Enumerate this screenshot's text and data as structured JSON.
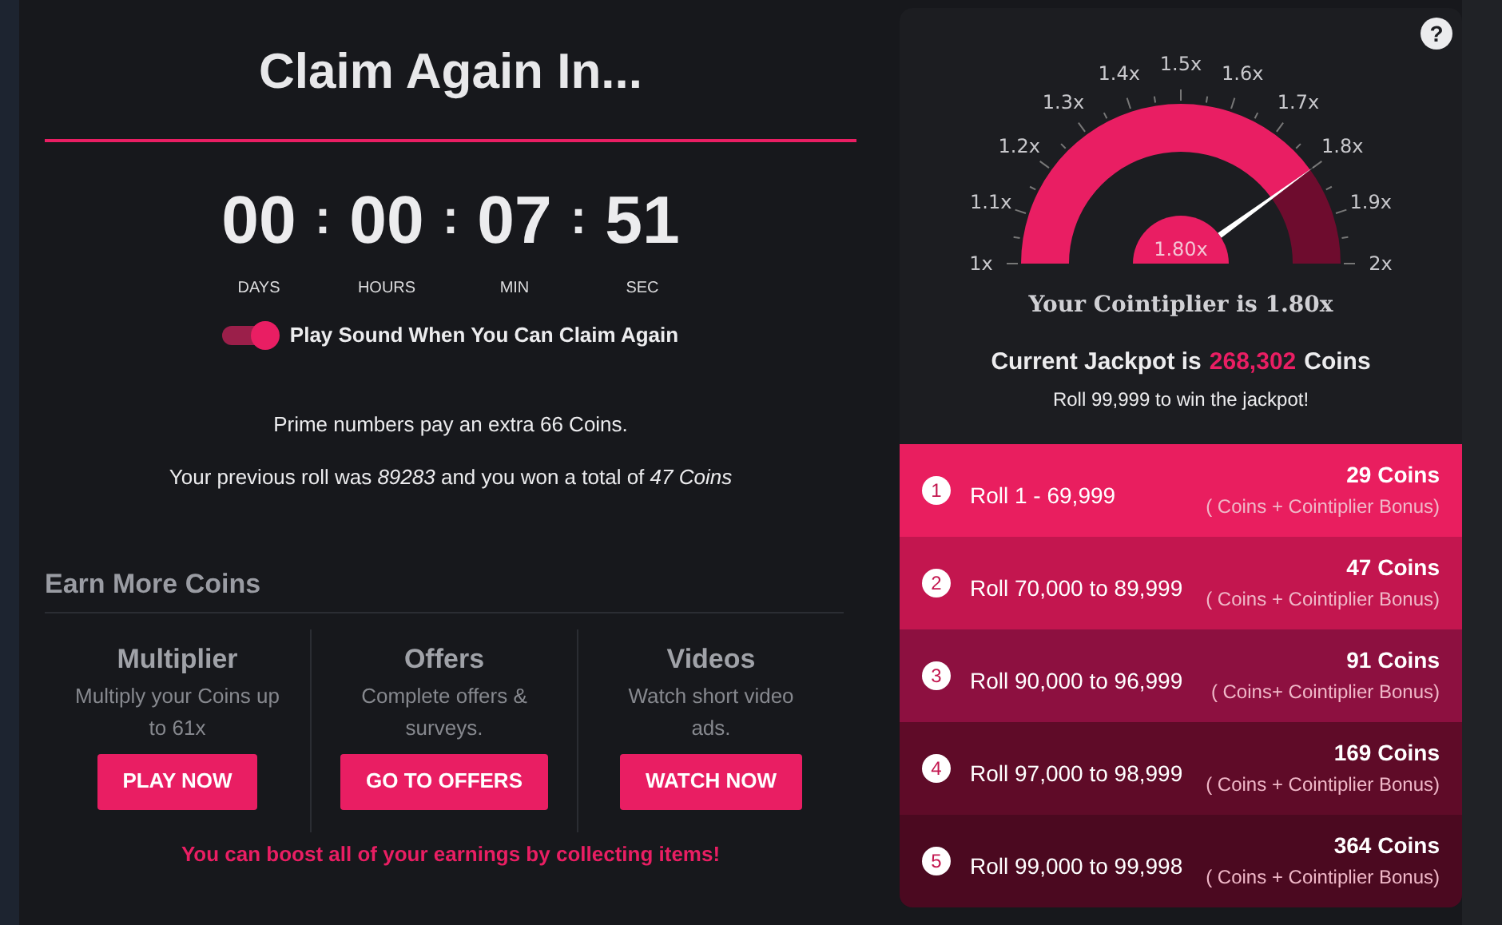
{
  "countdown": {
    "title": "Claim Again In...",
    "units": [
      {
        "value": "00",
        "label": "DAYS"
      },
      {
        "value": "00",
        "label": "HOURS"
      },
      {
        "value": "07",
        "label": "MIN"
      },
      {
        "value": "51",
        "label": "SEC"
      }
    ]
  },
  "separator": ":",
  "sound_toggle": {
    "label": "Play Sound When You Can Claim Again",
    "on": true
  },
  "prime_note": "Prime numbers pay an extra 66 Coins.",
  "previous_roll": "Your previous roll was *89283* and you won a total of *47 Coins*",
  "earn_more": {
    "title": "Earn More Coins",
    "options": [
      {
        "title": "Multiplier",
        "description": "Multiply your Coins up to 61x",
        "button": "PLAY NOW"
      },
      {
        "title": "Offers",
        "description": "Complete offers & surveys.",
        "button": "GO TO OFFERS"
      },
      {
        "title": "Videos",
        "description": "Watch short video ads.",
        "button": "WATCH NOW"
      }
    ]
  },
  "boost_note": "You can boost all of your earnings by collecting items!",
  "help_button": "?",
  "gauge": {
    "reading": "1.80x",
    "ticks": [
      "1x",
      "1.1x",
      "1.2x",
      "1.3x",
      "1.4x",
      "1.5x",
      "1.6x",
      "1.7x",
      "1.8x",
      "1.9x",
      "2x"
    ],
    "caption": "Your Cointiplier is 1.80x"
  },
  "jackpot": {
    "prefix": "Current Jackpot is",
    "amount": "268,302",
    "suffix": "Coins",
    "hint": "Roll 99,999 to win the jackpot!"
  },
  "tiers": [
    {
      "number": "1",
      "range": "Roll 1 - 69,999",
      "reward": "29 Coins",
      "note": "( Coins + Cointiplier Bonus)",
      "color": "#e91e5f"
    },
    {
      "number": "2",
      "range": "Roll 70,000 to 89,999",
      "reward": "47 Coins",
      "note": "( Coins + Cointiplier Bonus)",
      "color": "#c3164f"
    },
    {
      "number": "3",
      "range": "Roll 90,000 to 96,999",
      "reward": "91 Coins",
      "note": "( Coins+ Cointiplier Bonus)",
      "color": "#8d1040"
    },
    {
      "number": "4",
      "range": "Roll 97,000 to 98,999",
      "reward": "169 Coins",
      "note": "( Coins + Cointiplier Bonus)",
      "color": "#5f0b28"
    },
    {
      "number": "5",
      "range": "Roll 99,000 to 99,998",
      "reward": "364 Coins",
      "note": "( Coins + Cointiplier Bonus)",
      "color": "#4b0920"
    }
  ]
}
